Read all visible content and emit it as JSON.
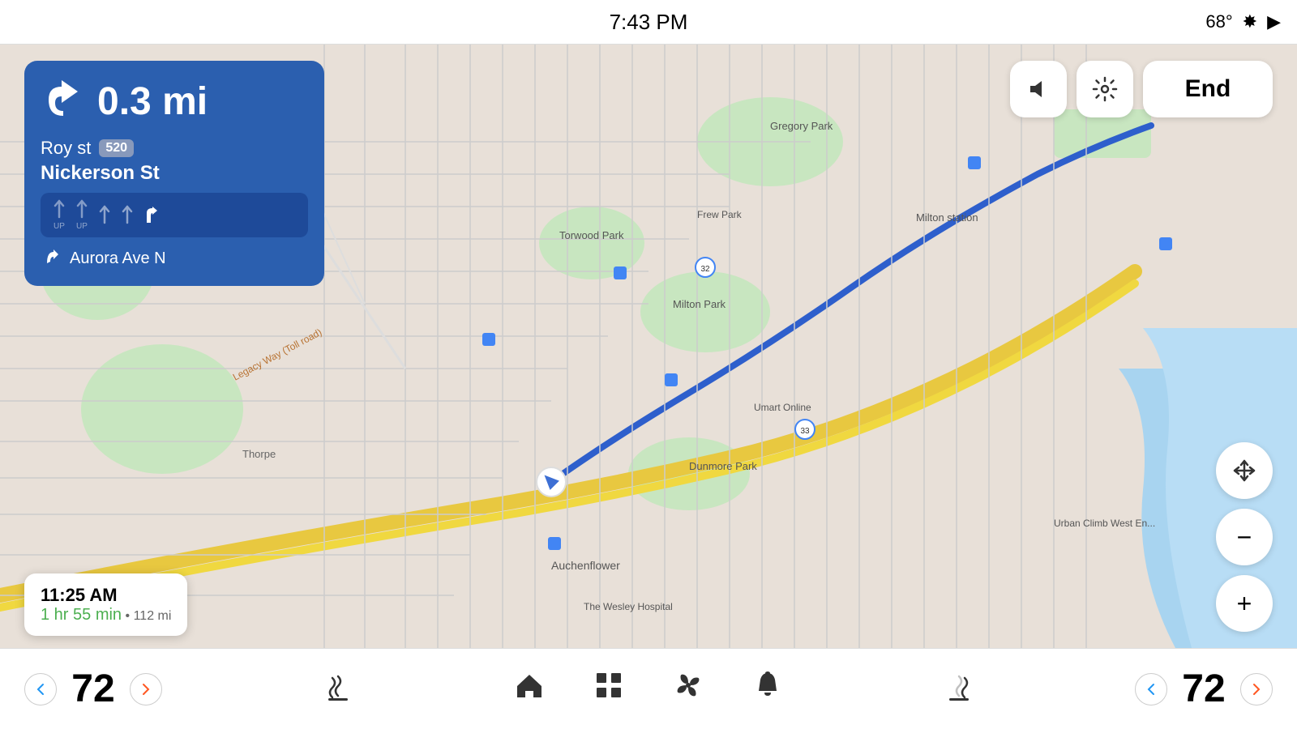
{
  "statusBar": {
    "time": "7:43 PM",
    "temperature": "68°",
    "bluetoothIcon": "bluetooth",
    "signalIcon": "signal"
  },
  "navCard": {
    "distance": "0.3 mi",
    "streetName": "Roy st",
    "routeBadge": "520",
    "crossStreet": "Nickerson St",
    "nextTurnStreet": "Aurora Ave N",
    "lanes": [
      {
        "label": "UP",
        "active": false
      },
      {
        "label": "UP",
        "active": false
      },
      {
        "label": "",
        "active": false
      },
      {
        "label": "",
        "active": false
      },
      {
        "label": "",
        "active": true
      }
    ]
  },
  "eta": {
    "arrivalTime": "11:25 AM",
    "duration": "1 hr 55 min",
    "separator": "•",
    "distance": "112 mi"
  },
  "controls": {
    "volumeLabel": "volume",
    "settingsLabel": "settings",
    "endLabel": "End"
  },
  "mapControls": {
    "moveLabel": "move",
    "zoomOutLabel": "−",
    "zoomInLabel": "+"
  },
  "bottomBar": {
    "leftTemp": "72",
    "rightTemp": "72",
    "leftTempUp": ">",
    "leftTempDown": "<",
    "rightTempUp": ">",
    "rightTempDown": "<"
  },
  "mapLabels": {
    "gregoryPark": "Gregory Park",
    "frewPark": "Frew Park",
    "torwoodPark": "Torwood Park",
    "miltonPark": "Milton Park",
    "miltonStation": "Milton station",
    "dunmorePark": "Dunmore Park",
    "auchenflower": "Auchenflower",
    "umart": "Umart Online",
    "wesleyHospital": "The Wesley Hospital",
    "urbanClimb": "Urban Climb West En...",
    "legacyWay": "Legacy Way (Toll road)",
    "thorpe": "Thorpe"
  }
}
